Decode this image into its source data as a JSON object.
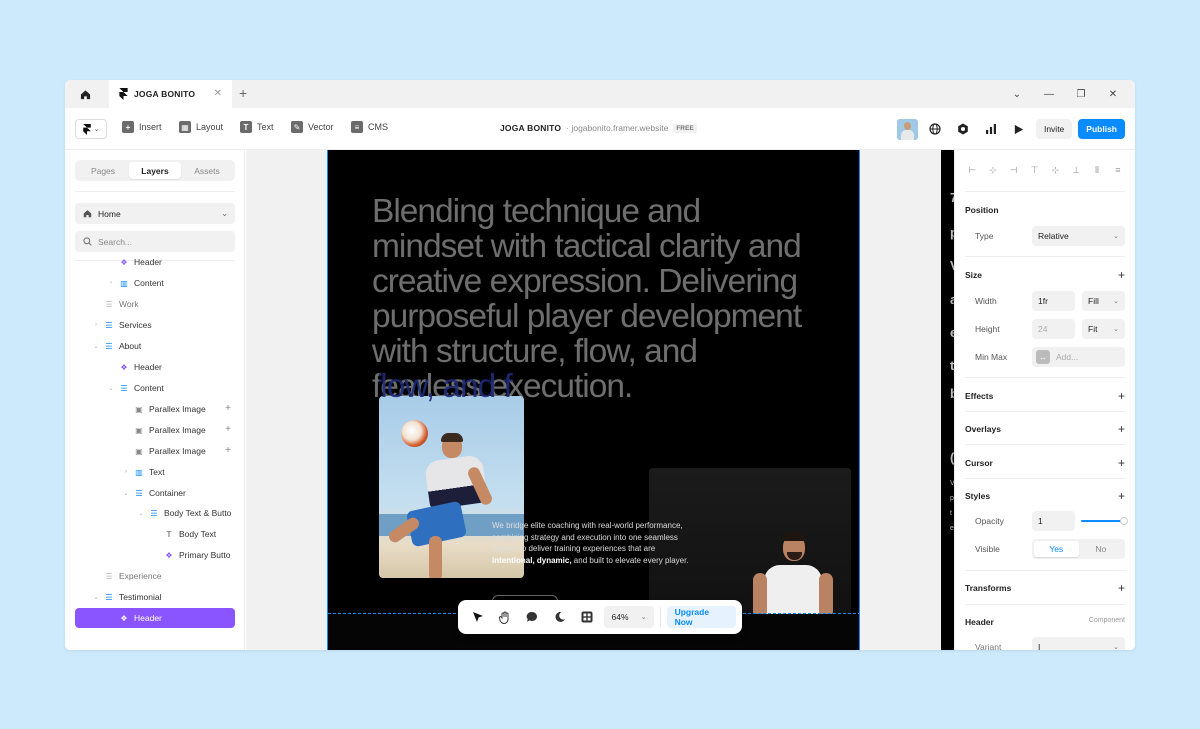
{
  "tab": {
    "title": "JOGA BONITO"
  },
  "toolbar": {
    "tools": [
      {
        "label": "Insert",
        "icon": "plus-icon"
      },
      {
        "label": "Layout",
        "icon": "layout-icon"
      },
      {
        "label": "Text",
        "icon": "text-icon"
      },
      {
        "label": "Vector",
        "icon": "pen-icon"
      },
      {
        "label": "CMS",
        "icon": "database-icon"
      }
    ],
    "site_name": "JOGA BONITO",
    "site_url": "jogabonito.framer.website",
    "plan_badge": "FREE",
    "invite_label": "Invite",
    "publish_label": "Publish"
  },
  "left_panel": {
    "tabs": [
      "Pages",
      "Layers",
      "Assets"
    ],
    "active_tab": "Layers",
    "page": "Home",
    "search_placeholder": "Search...",
    "layers": [
      {
        "label": "Header",
        "icon": "component",
        "indent": 2,
        "arrow": "",
        "state": "cut"
      },
      {
        "label": "Content",
        "icon": "columns",
        "indent": 2,
        "arrow": "›"
      },
      {
        "label": "Work",
        "icon": "stack-muted",
        "indent": 1,
        "arrow": "",
        "state": "muted"
      },
      {
        "label": "Services",
        "icon": "stack",
        "indent": 1,
        "arrow": "›"
      },
      {
        "label": "About",
        "icon": "stack",
        "indent": 1,
        "arrow": "⌄"
      },
      {
        "label": "Header",
        "icon": "component",
        "indent": 2,
        "arrow": ""
      },
      {
        "label": "Content",
        "icon": "stack",
        "indent": 2,
        "arrow": "⌄"
      },
      {
        "label": "Parallex Image",
        "icon": "image",
        "indent": 3,
        "arrow": "",
        "plus": true
      },
      {
        "label": "Parallex Image",
        "icon": "image",
        "indent": 3,
        "arrow": "",
        "plus": true
      },
      {
        "label": "Parallex Image",
        "icon": "image",
        "indent": 3,
        "arrow": "",
        "plus": true
      },
      {
        "label": "Text",
        "icon": "columns",
        "indent": 3,
        "arrow": "›"
      },
      {
        "label": "Container",
        "icon": "stack",
        "indent": 3,
        "arrow": "⌄"
      },
      {
        "label": "Body Text & Butto",
        "icon": "stack",
        "indent": 4,
        "arrow": "⌄"
      },
      {
        "label": "Body Text",
        "icon": "text",
        "indent": 5,
        "arrow": ""
      },
      {
        "label": "Primary Butto",
        "icon": "component",
        "indent": 5,
        "arrow": ""
      },
      {
        "label": "Experience",
        "icon": "stack-muted",
        "indent": 1,
        "arrow": "",
        "state": "muted"
      },
      {
        "label": "Testimonial",
        "icon": "stack",
        "indent": 1,
        "arrow": "⌄"
      },
      {
        "label": "Header",
        "icon": "component",
        "indent": 2,
        "arrow": "",
        "state": "selected"
      }
    ]
  },
  "canvas": {
    "headline": "Blending technique and mindset with tactical clarity and creative expression. Delivering purposeful player development with structure, flow, and fearless execution.",
    "overlay_text": "flow, and f",
    "body_copy_before": "We bridge elite coaching with real-world performance, combining strategy and execution into one seamless system to deliver training experiences that are ",
    "body_copy_bold": "intentional, dynamic,",
    "body_copy_after": " and built to elevate every player.",
    "peek_letters": [
      "7",
      "p",
      "V",
      "a",
      "e",
      "t",
      "b",
      "(",
      "V",
      "p",
      "t",
      "e"
    ]
  },
  "floating_bar": {
    "zoom": "64%",
    "upgrade_label": "Upgrade Now"
  },
  "right_panel": {
    "position": {
      "title": "Position",
      "type_label": "Type",
      "type_value": "Relative"
    },
    "size": {
      "title": "Size",
      "width_label": "Width",
      "width_value": "1fr",
      "width_mode": "Fill",
      "height_label": "Height",
      "height_value": "24",
      "height_mode": "Fit",
      "minmax_label": "Min Max",
      "minmax_placeholder": "Add..."
    },
    "effects_title": "Effects",
    "overlays_title": "Overlays",
    "cursor_title": "Cursor",
    "styles": {
      "title": "Styles",
      "opacity_label": "Opacity",
      "opacity_value": "1",
      "visible_label": "Visible",
      "visible_yes": "Yes",
      "visible_no": "No",
      "opacity_level": 1.0
    },
    "transforms_title": "Transforms",
    "header": {
      "title": "Header",
      "kind": "Component",
      "variant_label": "Variant"
    }
  },
  "colors": {
    "accent": "#0a8bff",
    "selection": "#8a55ff",
    "background": "#cdeafd"
  }
}
